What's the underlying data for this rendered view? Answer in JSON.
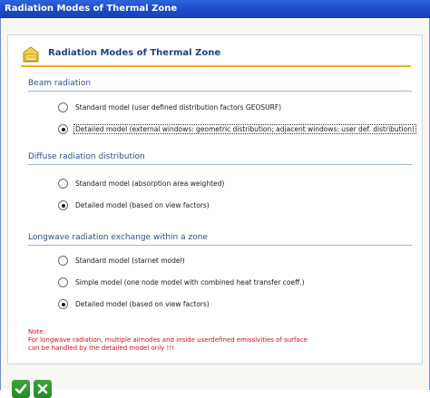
{
  "window": {
    "title": "Radiation Modes of Thermal Zone"
  },
  "panel": {
    "title": "Radiation Modes of Thermal Zone",
    "icon": "folder-icon"
  },
  "sections": [
    {
      "label": "Beam radiation",
      "options": [
        {
          "label": "Standard model (user defined distribution factors GEOSURF)",
          "selected": false
        },
        {
          "label": "Detailed model (external windows: geometric distribution; adjacent windows: user def. distribution)",
          "selected": true
        }
      ]
    },
    {
      "label": "Diffuse radiation distribution",
      "options": [
        {
          "label": "Standard model (absorption area weighted)",
          "selected": false
        },
        {
          "label": "Detailed model (based on view factors)",
          "selected": true
        }
      ]
    },
    {
      "label": "Longwave radiation exchange within a zone",
      "options": [
        {
          "label": "Standard model (starnet model)",
          "selected": false
        },
        {
          "label": "Simple model (one node model with combined heat transfer coeff.)",
          "selected": false
        },
        {
          "label": "Detailed model (based on view factors)",
          "selected": true
        }
      ]
    }
  ],
  "note": {
    "heading": "Note:",
    "line1": "For longwave radiation, multiple airnodes and inside userdefined  emissivities of surface",
    "line2": "can be handled by the detailed model only !!!"
  },
  "buttons": {
    "ok_icon": "checkmark-icon",
    "cancel_icon": "close-icon"
  },
  "colors": {
    "accent_line": "#f0b400",
    "title_text": "#1c3f8c",
    "note_text": "#d01010",
    "button_green": "#2a8a24"
  }
}
